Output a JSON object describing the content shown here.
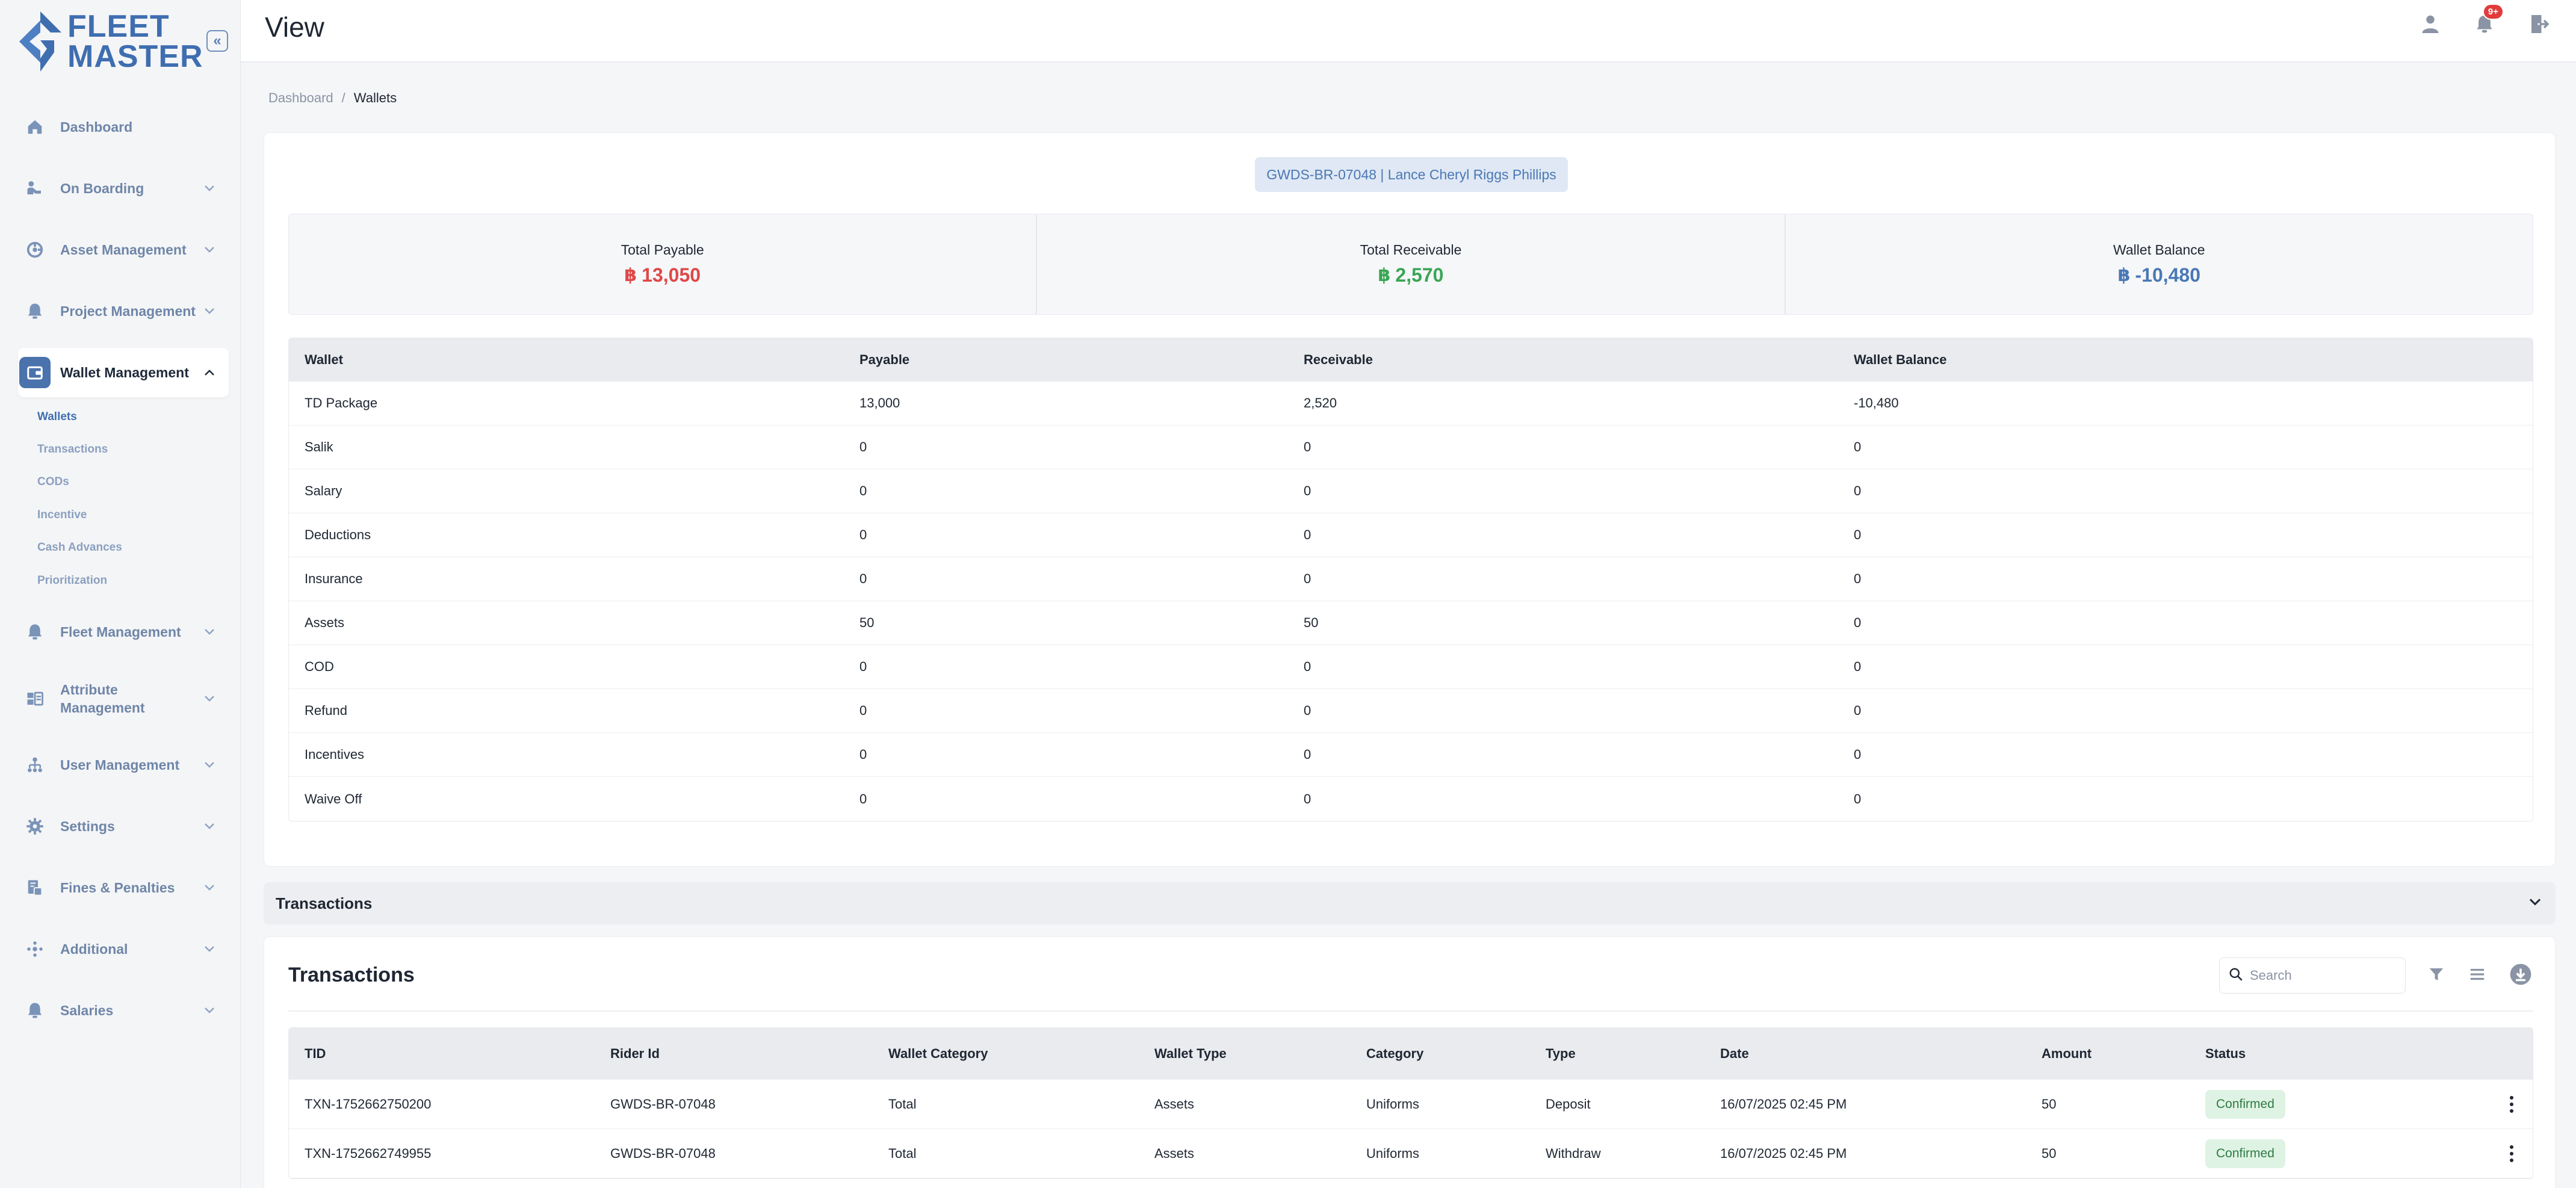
{
  "app": {
    "logo_line1": "FLEET",
    "logo_line2": "MASTER",
    "collapse_glyph": "«"
  },
  "header": {
    "title": "View",
    "notification_count": "9+"
  },
  "sidebar": {
    "items": [
      {
        "label": "Dashboard",
        "icon": "home-icon"
      },
      {
        "label": "On Boarding",
        "icon": "onboarding-icon"
      },
      {
        "label": "Asset Management",
        "icon": "asset-icon"
      },
      {
        "label": "Project Management",
        "icon": "project-icon"
      },
      {
        "label": "Wallet Management",
        "icon": "wallet-icon",
        "active": true
      },
      {
        "label": "Fleet Management",
        "icon": "fleet-icon"
      },
      {
        "label": "Attribute Management",
        "icon": "attribute-icon"
      },
      {
        "label": "User Management",
        "icon": "users-icon"
      },
      {
        "label": "Settings",
        "icon": "gear-icon"
      },
      {
        "label": "Fines & Penalties",
        "icon": "fines-icon"
      },
      {
        "label": "Additional",
        "icon": "additional-icon"
      },
      {
        "label": "Salaries",
        "icon": "salaries-icon"
      }
    ],
    "wallet_sub": [
      "Wallets",
      "Transactions",
      "CODs",
      "Incentive",
      "Cash Advances",
      "Prioritization"
    ]
  },
  "breadcrumb": {
    "root": "Dashboard",
    "separator": "/",
    "current": "Wallets"
  },
  "rider": {
    "chip": "GWDS-BR-07048 | Lance Cheryl Riggs Phillips"
  },
  "summary": {
    "currency_glyph": "฿",
    "total_payable_label": "Total Payable",
    "total_payable": "13,050",
    "total_receivable_label": "Total Receivable",
    "total_receivable": "2,570",
    "wallet_balance_label": "Wallet Balance",
    "wallet_balance": "-10,480",
    "colors": {
      "payable": "#e04848",
      "receivable": "#3aa655",
      "balance": "#4a78b5"
    }
  },
  "wallet_table": {
    "headers": [
      "Wallet",
      "Payable",
      "Receivable",
      "Wallet Balance"
    ],
    "rows": [
      [
        "TD Package",
        "13,000",
        "2,520",
        "-10,480"
      ],
      [
        "Salik",
        "0",
        "0",
        "0"
      ],
      [
        "Salary",
        "0",
        "0",
        "0"
      ],
      [
        "Deductions",
        "0",
        "0",
        "0"
      ],
      [
        "Insurance",
        "0",
        "0",
        "0"
      ],
      [
        "Assets",
        "50",
        "50",
        "0"
      ],
      [
        "COD",
        "0",
        "0",
        "0"
      ],
      [
        "Refund",
        "0",
        "0",
        "0"
      ],
      [
        "Incentives",
        "0",
        "0",
        "0"
      ],
      [
        "Waive Off",
        "0",
        "0",
        "0"
      ]
    ]
  },
  "accordion": {
    "title": "Transactions"
  },
  "transactions": {
    "title": "Transactions",
    "search_placeholder": "Search",
    "headers": [
      "TID",
      "Rider Id",
      "Wallet Category",
      "Wallet Type",
      "Category",
      "Type",
      "Date",
      "Amount",
      "Status"
    ],
    "rows": [
      [
        "TXN-1752662750200",
        "GWDS-BR-07048",
        "Total",
        "Assets",
        "Uniforms",
        "Deposit",
        "16/07/2025 02:45 PM",
        "50",
        "Confirmed"
      ],
      [
        "TXN-1752662749955",
        "GWDS-BR-07048",
        "Total",
        "Assets",
        "Uniforms",
        "Withdraw",
        "16/07/2025 02:45 PM",
        "50",
        "Confirmed"
      ]
    ]
  }
}
